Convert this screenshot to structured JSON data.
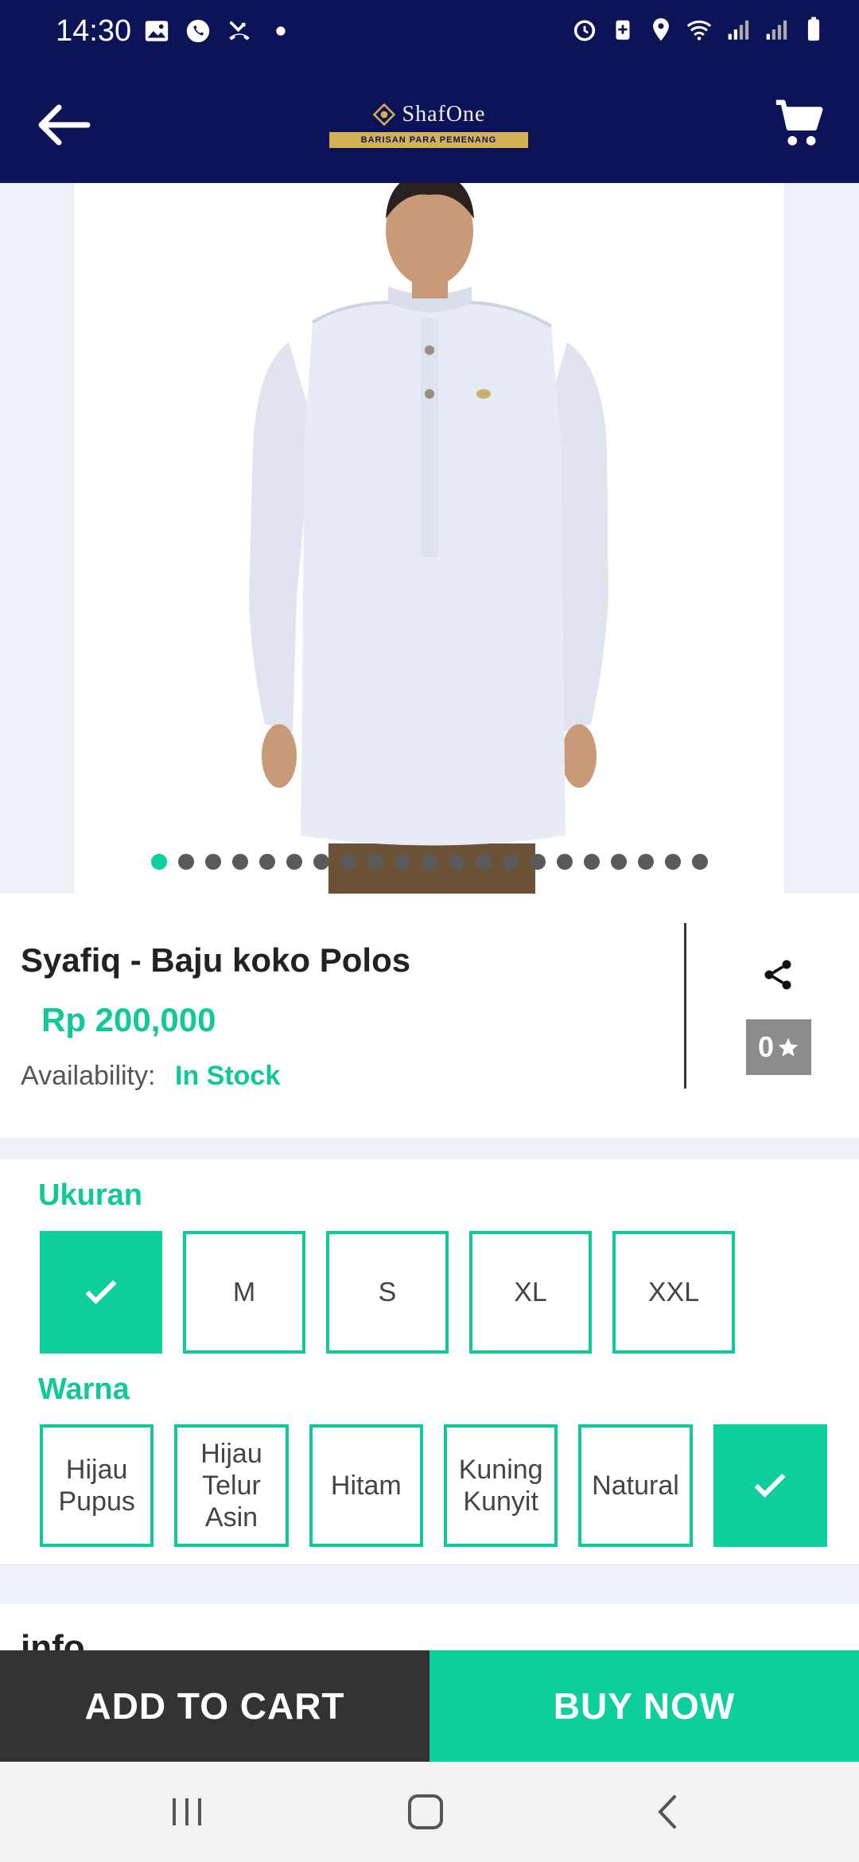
{
  "status_bar": {
    "time": "14:30",
    "left_icons": [
      "gallery-icon",
      "whatsapp-icon",
      "missed-call-icon",
      "dot-icon"
    ],
    "right_icons": [
      "alarm-icon",
      "battery-saver-icon",
      "location-icon",
      "wifi-icon",
      "signal-icon",
      "signal-icon",
      "battery-icon"
    ]
  },
  "app_bar": {
    "back_icon": "arrow-left-icon",
    "cart_icon": "cart-icon",
    "logo": {
      "brand": "ShafOne",
      "tagline": "BARISAN PARA PEMENANG"
    }
  },
  "carousel": {
    "image_count": 21,
    "active_index": 0
  },
  "product": {
    "title": "Syafiq - Baju koko Polos",
    "price": "Rp 200,000",
    "availability_label": "Availability:",
    "availability_value": "In Stock",
    "rating": "0",
    "share_icon": "share-icon",
    "star_icon": "star-icon"
  },
  "options": {
    "size": {
      "label": "Ukuran",
      "items": [
        {
          "label": "",
          "selected": true
        },
        {
          "label": "M",
          "selected": false
        },
        {
          "label": "S",
          "selected": false
        },
        {
          "label": "XL",
          "selected": false
        },
        {
          "label": "XXL",
          "selected": false
        }
      ]
    },
    "color": {
      "label": "Warna",
      "items": [
        {
          "label": "Hijau Pupus",
          "selected": false
        },
        {
          "label": "Hijau Telur Asin",
          "selected": false
        },
        {
          "label": "Hitam",
          "selected": false
        },
        {
          "label": "Kuning Kunyit",
          "selected": false
        },
        {
          "label": "Natural",
          "selected": false
        },
        {
          "label": "",
          "selected": true
        }
      ]
    }
  },
  "info_section": {
    "title": "info"
  },
  "actions": {
    "add_to_cart": "ADD TO CART",
    "buy_now": "BUY NOW"
  },
  "colors": {
    "primary_navy": "#0c1356",
    "accent_green": "#0ccf9b",
    "dark_button": "#333333"
  }
}
